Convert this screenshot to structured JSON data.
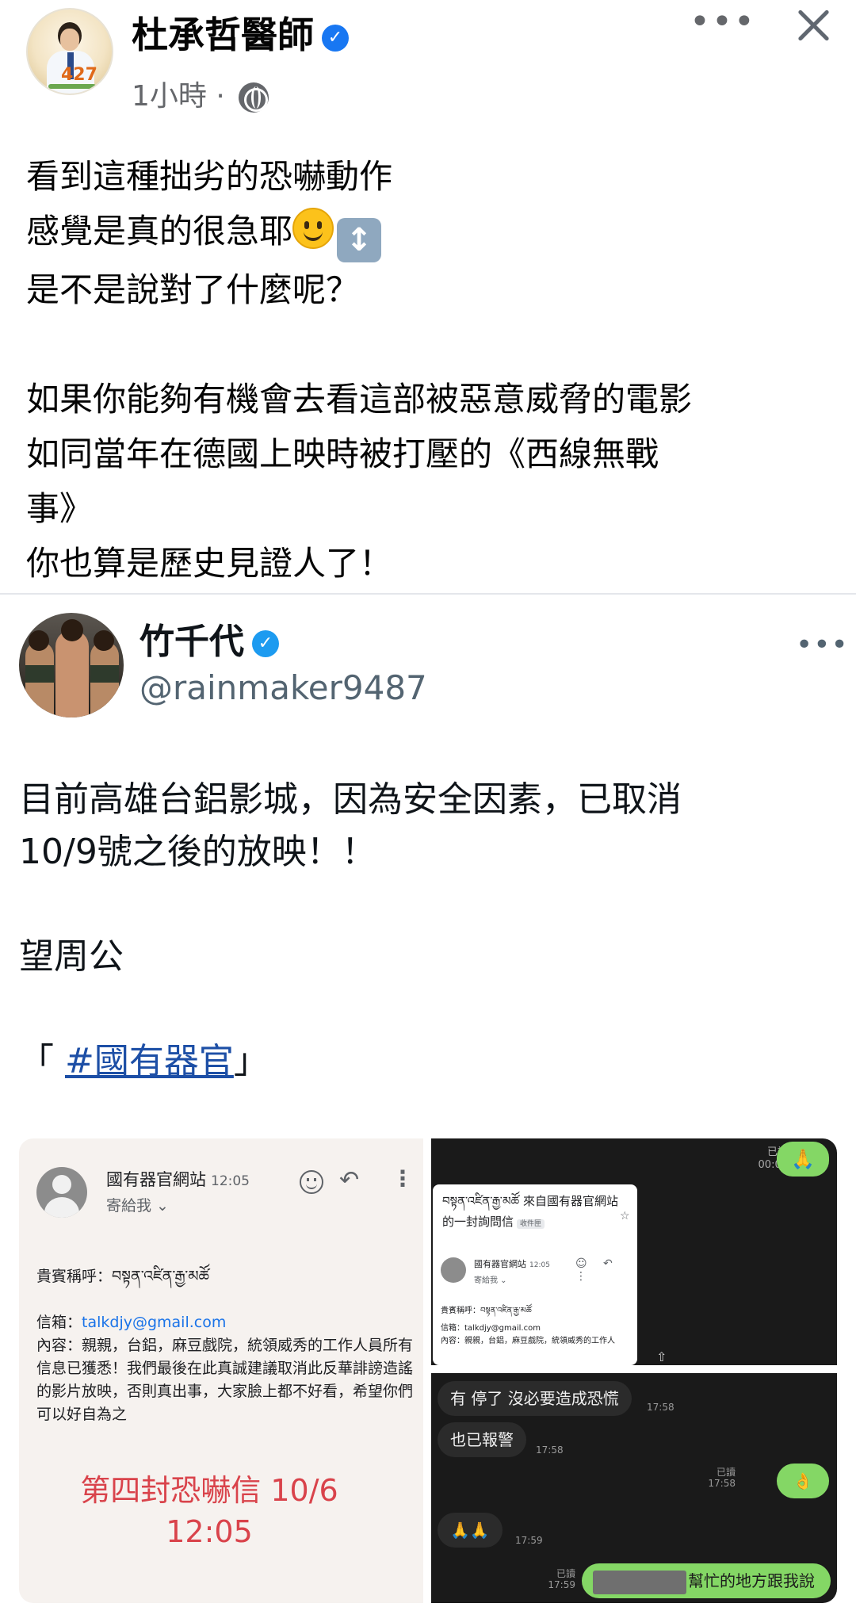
{
  "header": {
    "author_name": "杜承哲醫師",
    "verified_glyph": "✓",
    "meta_time": "1小時 · ",
    "avatar_numeral": "427",
    "more_label": "•••"
  },
  "post": {
    "lines": [
      "看到這種拙劣的恐嚇動作",
      "感覺是真的很急耶",
      "是不是說對了什麼呢？",
      "",
      "如果你能夠有機會去看這部被惡意威脅的電影",
      "如同當年在德國上映時被打壓的《西線無戰",
      "事》",
      "你也算是歷史見證人了！"
    ],
    "emoji_updown": "↕"
  },
  "embedded": {
    "name": "竹千代",
    "verified_glyph": "✓",
    "handle": "@rainmaker9487",
    "more_label": "•••",
    "text_lines": [
      "目前高雄台鋁影城，因為安全因素，已取消",
      "10/9號之後的放映！！",
      "",
      "望周公",
      ""
    ],
    "quote_open": "「 ",
    "hashtag": "#國有器官",
    "quote_close": "」"
  },
  "email": {
    "sender": "國有器官網站",
    "time": "12:05",
    "to": "寄給我 ⌄",
    "reply_glyph": "↶",
    "more_glyph": "⋮",
    "greeting": "貴賓稱呼：བསྟན་འཛིན་རྒྱ་མཚོ",
    "mail_label": "信箱：",
    "mail_value": "talkdjy@gmail.com",
    "content": "內容：親親，台鋁，麻豆戲院，統領威秀的工作人員所有信息已獲悉！我們最後在此真誠建議取消此反華誹謗造謠的影片放映，否則真出事，大家臉上都不好看，希望你們可以好自為之",
    "caption_line1": "第四封恐嚇信 10/6",
    "caption_line2": "12:05"
  },
  "chat_top": {
    "read_label": "已讀",
    "read_time": "00:00",
    "bubble_emoji": "🙏",
    "card_title": "བསྟན་འཛིན་རྒྱ་མཚོ 來自國有器官網站的一封詢問信",
    "card_tag": "收件匣",
    "star_glyph": "☆",
    "card_sender": "國有器官網站",
    "card_time": "12:05",
    "card_to": "寄給我 ⌄",
    "card_icons": "☺ ↶ ⋮",
    "card_greeting": "貴賓稱呼：བསྟན་འཛིན་རྒྱ་མཚོ",
    "card_mail": "信箱：talkdjy@gmail.com",
    "card_content": "內容：親親，台鋁，麻豆戲院，統領威秀的工作人",
    "share_glyph": "⇧"
  },
  "chat_bottom": {
    "msg1": "有 停了 沒必要造成恐慌",
    "msg1_time": "17:58",
    "msg2": "也已報警",
    "msg2_time": "17:58",
    "out1_read": "已讀",
    "out1_time": "17:58",
    "out1_emoji": "👌",
    "msg3": "🙏🙏",
    "msg3_time": "17:59",
    "out2_read": "已讀",
    "out2_time": "17:59",
    "out2_text": "幫忙的地方跟我說"
  }
}
